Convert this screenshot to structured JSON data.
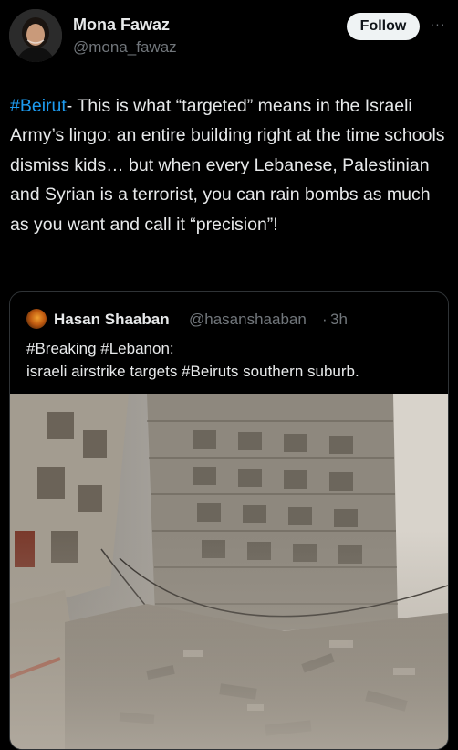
{
  "author": {
    "display_name": "Mona Fawaz",
    "handle": "@mona_fawaz",
    "follow_label": "Follow",
    "more_label": "···"
  },
  "tweet": {
    "hashtag": "#Beirut",
    "text": "- This is what “targeted” means in the Israeli Army’s lingo: an entire building right at the time schools dismiss kids… but when every Lebanese, Palestinian and Syrian is a terrorist, you can rain bombs as much as you want and call it “precision”!"
  },
  "quoted_tweet": {
    "display_name": "Hasan Shaaban",
    "handle": "@hasanshaaban",
    "separator": "·",
    "time": "3h",
    "line1": "#Breaking #Lebanon:",
    "line2": "israeli airstrike targets #Beiruts southern suburb."
  },
  "colors": {
    "background": "#000000",
    "text": "#e7e9ea",
    "secondary_text": "#71767b",
    "link": "#1d9bf0",
    "border": "#2f3336"
  }
}
